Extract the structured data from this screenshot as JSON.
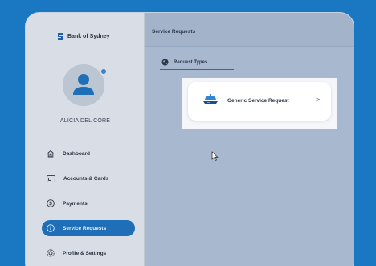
{
  "brand": {
    "name": "Bank of Sydney"
  },
  "user": {
    "name": "ALICIA DEL CORE"
  },
  "nav": {
    "items": [
      {
        "id": "dashboard",
        "label": "Dashboard",
        "icon": "home-icon"
      },
      {
        "id": "accounts",
        "label": "Accounts & Cards",
        "icon": "card-icon"
      },
      {
        "id": "payments",
        "label": "Payments",
        "icon": "dollar-icon"
      },
      {
        "id": "service-requests",
        "label": "Service Requests",
        "icon": "info-icon",
        "active": true
      },
      {
        "id": "profile",
        "label": "Profile & Settings",
        "icon": "gear-icon"
      }
    ]
  },
  "main": {
    "title": "Service Requests",
    "tab": {
      "label": "Request Types",
      "icon": "globe-icon"
    },
    "card": {
      "label": "Generic Service Request",
      "icon": "service-bell-icon",
      "chevron": ">"
    }
  },
  "colors": {
    "outer_bg": "#1a78c2",
    "sidebar_bg": "#d8dde6",
    "main_bg": "#a8b8cf",
    "active_nav": "#1f6fb8",
    "accent": "#2f86d6"
  }
}
